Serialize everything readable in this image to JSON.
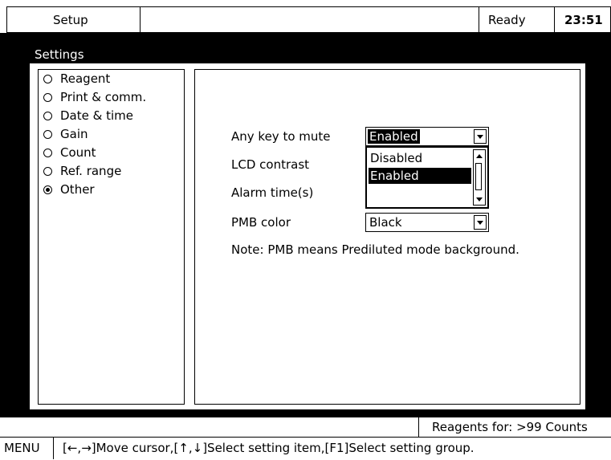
{
  "header": {
    "section": "Setup",
    "status": "Ready",
    "time": "23:51"
  },
  "panel": {
    "title": "Settings"
  },
  "groups": [
    {
      "label": "Reagent",
      "selected": false
    },
    {
      "label": "Print & comm.",
      "selected": false
    },
    {
      "label": "Date & time",
      "selected": false
    },
    {
      "label": "Gain",
      "selected": false
    },
    {
      "label": "Count",
      "selected": false
    },
    {
      "label": "Ref. range",
      "selected": false
    },
    {
      "label": "Other",
      "selected": true
    }
  ],
  "settings": {
    "mute_label": "Any key to mute",
    "mute_value": "Enabled",
    "mute_options": [
      "Disabled",
      "Enabled"
    ],
    "mute_option_selected": "Enabled",
    "lcd_label": "LCD contrast",
    "alarm_label": "Alarm time(s)",
    "pmb_label": "PMB color",
    "pmb_value": "Black",
    "note": "Note: PMB means Prediluted mode background."
  },
  "status": {
    "reagents": "Reagents for: >99 Counts",
    "menu": "MENU",
    "hint": "[←,→]Move cursor,[↑,↓]Select setting item,[F1]Select setting group."
  },
  "icons": {
    "dropdown": "chevron-down-icon",
    "scroll_up": "arrow-up-icon",
    "scroll_down": "arrow-down-icon"
  }
}
